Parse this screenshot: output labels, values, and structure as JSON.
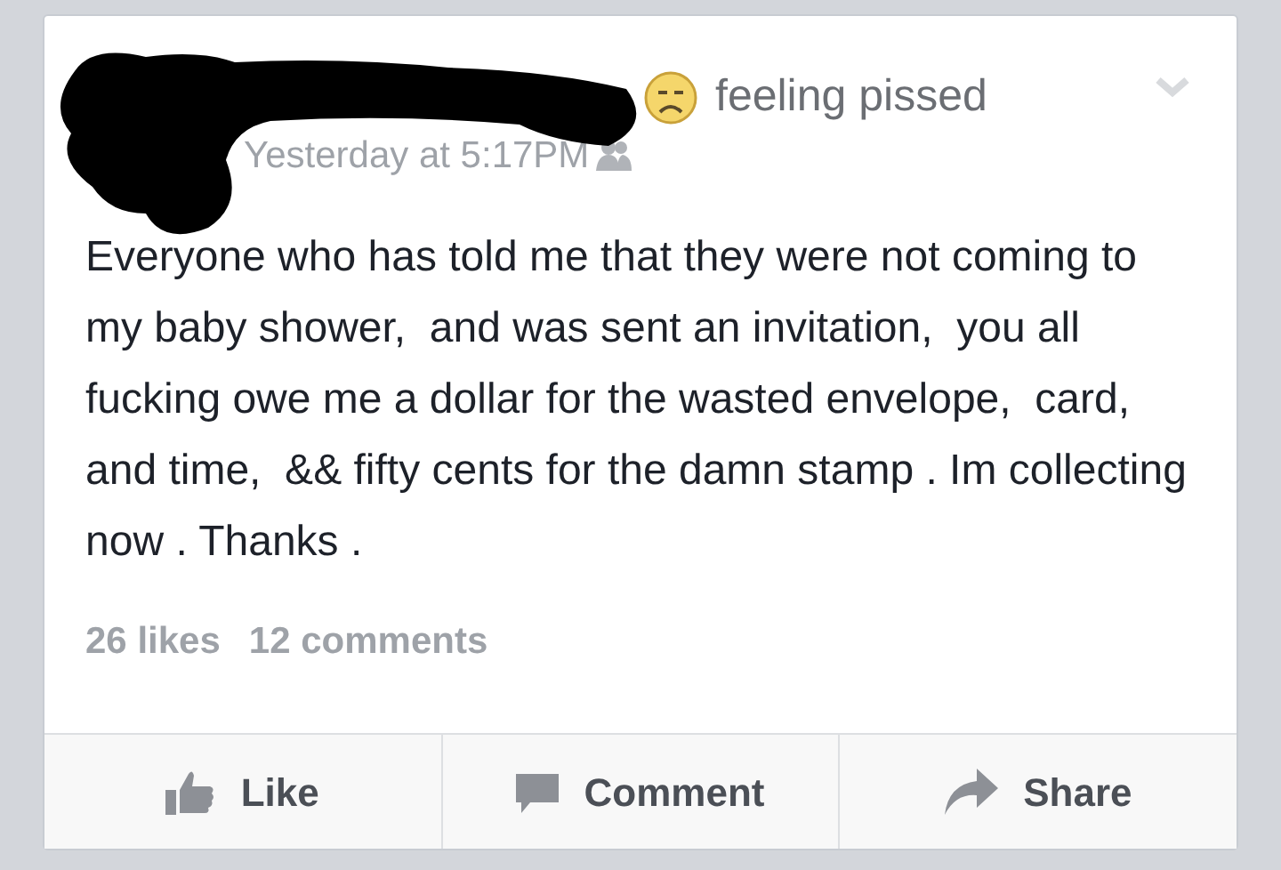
{
  "post": {
    "feeling": "feeling pissed",
    "timestamp": "Yesterday at 5:17PM",
    "text": "Everyone who has told me that they were not coming to my baby shower,  and was sent an invitation,  you all fucking owe me a dollar for the wasted envelope,  card,  and time,  && fifty cents for the damn stamp . Im collecting now . Thanks .",
    "likes": "26 likes",
    "comments": "12 comments"
  },
  "actions": [
    {
      "kind": "like",
      "label": "Like"
    },
    {
      "kind": "comment",
      "label": "Comment"
    },
    {
      "kind": "share",
      "label": "Share"
    }
  ]
}
